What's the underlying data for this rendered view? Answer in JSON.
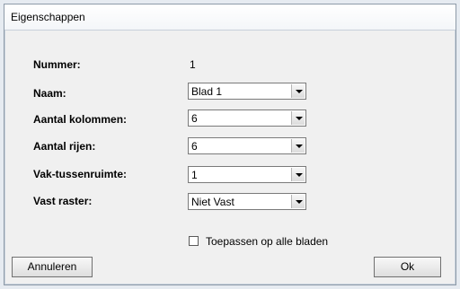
{
  "window": {
    "title": "Eigenschappen"
  },
  "fields": {
    "nummer": {
      "label": "Nummer:",
      "value": "1"
    },
    "naam": {
      "label": "Naam:",
      "value": "Blad 1"
    },
    "kolommen": {
      "label": "Aantal kolommen:",
      "value": "6"
    },
    "rijen": {
      "label": "Aantal rijen:",
      "value": "6"
    },
    "tussenruimte": {
      "label": "Vak-tussenruimte:",
      "value": "1"
    },
    "raster": {
      "label": "Vast raster:",
      "value": "Niet Vast"
    }
  },
  "apply_all": {
    "label": "Toepassen op alle bladen",
    "checked": false
  },
  "buttons": {
    "cancel": "Annuleren",
    "ok": "Ok"
  }
}
